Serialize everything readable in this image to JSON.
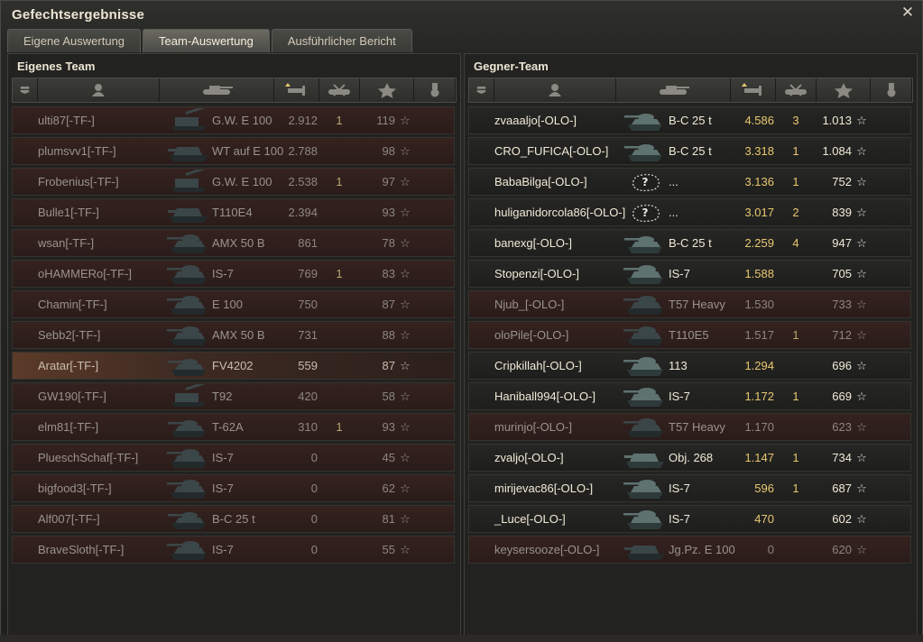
{
  "window": {
    "title": "Gefechtsergebnisse"
  },
  "tabs": [
    {
      "label": "Eigene Auswertung",
      "active": false
    },
    {
      "label": "Team-Auswertung",
      "active": true
    },
    {
      "label": "Ausführlicher Bericht",
      "active": false
    }
  ],
  "colors": {
    "accent": "#e8c870",
    "dead_row": "#35221f",
    "self_row": "#5b3a28"
  },
  "left_team": {
    "title": "Eigenes Team",
    "rows": [
      {
        "name": "ulti87[-TF-]",
        "tank": "G.W. E 100",
        "damage": "2.912",
        "kills": "1",
        "xp": "119",
        "state": "dead",
        "icon": "spg-icon"
      },
      {
        "name": "plumsvv1[-TF-]",
        "tank": "WT auf E 100",
        "damage": "2.788",
        "kills": "",
        "xp": "98",
        "state": "dead",
        "icon": "td-icon"
      },
      {
        "name": "Frobenius[-TF-]",
        "tank": "G.W. E 100",
        "damage": "2.538",
        "kills": "1",
        "xp": "97",
        "state": "dead",
        "icon": "spg-icon"
      },
      {
        "name": "Bulle1[-TF-]",
        "tank": "T110E4",
        "damage": "2.394",
        "kills": "",
        "xp": "93",
        "state": "dead",
        "icon": "td-icon"
      },
      {
        "name": "wsan[-TF-]",
        "tank": "AMX 50 B",
        "damage": "861",
        "kills": "",
        "xp": "78",
        "state": "dead",
        "icon": "heavy-tank-icon"
      },
      {
        "name": "oHAMMERo[-TF-]",
        "tank": "IS-7",
        "damage": "769",
        "kills": "1",
        "xp": "83",
        "state": "dead",
        "icon": "heavy-tank-icon"
      },
      {
        "name": "Chamin[-TF-]",
        "tank": "E 100",
        "damage": "750",
        "kills": "",
        "xp": "87",
        "state": "dead",
        "icon": "heavy-tank-icon"
      },
      {
        "name": "Sebb2[-TF-]",
        "tank": "AMX 50 B",
        "damage": "731",
        "kills": "",
        "xp": "88",
        "state": "dead",
        "icon": "heavy-tank-icon"
      },
      {
        "name": "Aratar[-TF-]",
        "tank": "FV4202",
        "damage": "559",
        "kills": "",
        "xp": "87",
        "state": "self",
        "icon": "medium-tank-icon"
      },
      {
        "name": "GW190[-TF-]",
        "tank": "T92",
        "damage": "420",
        "kills": "",
        "xp": "58",
        "state": "dead",
        "icon": "spg-icon"
      },
      {
        "name": "elm81[-TF-]",
        "tank": "T-62A",
        "damage": "310",
        "kills": "1",
        "xp": "93",
        "state": "dead",
        "icon": "medium-tank-icon"
      },
      {
        "name": "PlueschSchaf[-TF-]",
        "tank": "IS-7",
        "damage": "0",
        "kills": "",
        "xp": "45",
        "state": "dead",
        "icon": "heavy-tank-icon"
      },
      {
        "name": "bigfood3[-TF-]",
        "tank": "IS-7",
        "damage": "0",
        "kills": "",
        "xp": "62",
        "state": "dead",
        "icon": "heavy-tank-icon"
      },
      {
        "name": "Alf007[-TF-]",
        "tank": "B-C 25 t",
        "damage": "0",
        "kills": "",
        "xp": "81",
        "state": "dead",
        "icon": "medium-tank-icon"
      },
      {
        "name": "BraveSloth[-TF-]",
        "tank": "IS-7",
        "damage": "0",
        "kills": "",
        "xp": "55",
        "state": "dead",
        "icon": "heavy-tank-icon"
      }
    ]
  },
  "right_team": {
    "title": "Gegner-Team",
    "rows": [
      {
        "name": "zvaaaljo[-OLO-]",
        "tank": "B-C 25 t",
        "damage": "4.586",
        "kills": "3",
        "xp": "1.013",
        "state": "alive",
        "icon": "medium-tank-icon"
      },
      {
        "name": "CRO_FUFICA[-OLO-]",
        "tank": "B-C 25 t",
        "damage": "3.318",
        "kills": "1",
        "xp": "1.084",
        "state": "alive",
        "icon": "medium-tank-icon"
      },
      {
        "name": "BabaBilga[-OLO-]",
        "tank": "...",
        "damage": "3.136",
        "kills": "1",
        "xp": "752",
        "state": "alive",
        "icon": "unknown-tank-icon"
      },
      {
        "name": "huliganidorcola86[-OLO-]",
        "tank": "...",
        "damage": "3.017",
        "kills": "2",
        "xp": "839",
        "state": "alive",
        "icon": "unknown-tank-icon"
      },
      {
        "name": "banexg[-OLO-]",
        "tank": "B-C 25 t",
        "damage": "2.259",
        "kills": "4",
        "xp": "947",
        "state": "alive",
        "icon": "medium-tank-icon"
      },
      {
        "name": "Stopenzi[-OLO-]",
        "tank": "IS-7",
        "damage": "1.588",
        "kills": "",
        "xp": "705",
        "state": "alive",
        "icon": "heavy-tank-icon"
      },
      {
        "name": "Njub_[-OLO-]",
        "tank": "T57 Heavy",
        "damage": "1.530",
        "kills": "",
        "xp": "733",
        "state": "dead",
        "icon": "heavy-tank-icon"
      },
      {
        "name": "oloPile[-OLO-]",
        "tank": "T110E5",
        "damage": "1.517",
        "kills": "1",
        "xp": "712",
        "state": "dead",
        "icon": "heavy-tank-icon"
      },
      {
        "name": "Cripkillah[-OLO-]",
        "tank": "113",
        "damage": "1.294",
        "kills": "",
        "xp": "696",
        "state": "alive",
        "icon": "heavy-tank-icon"
      },
      {
        "name": "Haniball994[-OLO-]",
        "tank": "IS-7",
        "damage": "1.172",
        "kills": "1",
        "xp": "669",
        "state": "alive",
        "icon": "heavy-tank-icon"
      },
      {
        "name": "murinjo[-OLO-]",
        "tank": "T57 Heavy",
        "damage": "1.170",
        "kills": "",
        "xp": "623",
        "state": "dead",
        "icon": "heavy-tank-icon"
      },
      {
        "name": "zvaljo[-OLO-]",
        "tank": "Obj. 268",
        "damage": "1.147",
        "kills": "1",
        "xp": "734",
        "state": "alive",
        "icon": "td-icon"
      },
      {
        "name": "mirijevac86[-OLO-]",
        "tank": "IS-7",
        "damage": "596",
        "kills": "1",
        "xp": "687",
        "state": "alive",
        "icon": "heavy-tank-icon"
      },
      {
        "name": "_Luce[-OLO-]",
        "tank": "IS-7",
        "damage": "470",
        "kills": "",
        "xp": "602",
        "state": "alive",
        "icon": "heavy-tank-icon"
      },
      {
        "name": "keysersooze[-OLO-]",
        "tank": "Jg.Pz. E 100",
        "damage": "0",
        "kills": "",
        "xp": "620",
        "state": "dead",
        "icon": "td-icon"
      }
    ]
  },
  "header_icons": [
    "squad-icon",
    "player-icon",
    "tank-icon",
    "damage-icon",
    "kills-icon",
    "xp-star-icon",
    "medal-icon"
  ],
  "star_glyph": "☆",
  "unknown_glyph": "?"
}
